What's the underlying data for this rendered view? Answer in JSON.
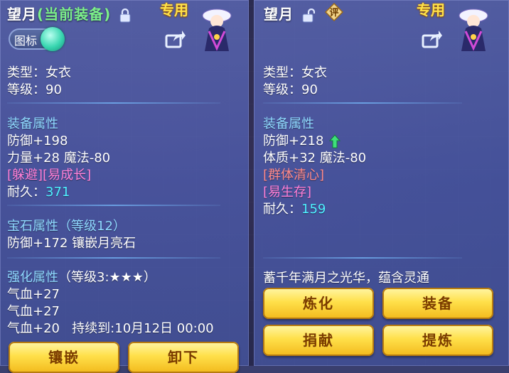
{
  "left": {
    "title_name": "望月",
    "title_status": "(当前装备)",
    "badge": "专用",
    "toggle_label": "图标",
    "type_line": "类型：女衣",
    "level_line": "等级：90",
    "attr_header": "装备属性",
    "defense_line": "防御+198",
    "stats_line": "力量+28 魔法-80",
    "special_line": "[躲避][易成长]",
    "durability_label": "耐久：",
    "durability_value": "371",
    "gem_header": "宝石属性（等级12）",
    "gem_line": "防御+172 镶嵌月亮石",
    "enhance_header": "强化属性",
    "enhance_level": "（等级3:★★★）",
    "hp_line1": "气血+27",
    "hp_line2": "气血+27",
    "hp_line3": "气血+20",
    "duration_line": "持续到:10月12日 00:00",
    "buttons": [
      "镶嵌",
      "卸下"
    ]
  },
  "right": {
    "title_name": "望月",
    "rate_icon_label": "评",
    "badge": "专用",
    "type_line": "类型：女衣",
    "level_line": "等级：90",
    "attr_header": "装备属性",
    "defense_line": "防御+218",
    "stats_line": "体质+32 魔法-80",
    "special_line1": "[群体清心]",
    "special_line2": "[易生存]",
    "durability_label": "耐久：",
    "durability_value": "159",
    "description": "蓄千年满月之光华，蕴含灵通",
    "buttons": [
      "炼化",
      "装备",
      "捐献",
      "提炼"
    ]
  },
  "colors": {
    "title_status": "#7cf08a",
    "badge": "#ffe24a",
    "section_header": "#8fd9ff",
    "special_pink": "#ff80d8",
    "special_red": "#ff8a8a",
    "durability": "#4ef0ff",
    "button_gold": "#ffe04a",
    "button_text": "#7a3b00"
  }
}
